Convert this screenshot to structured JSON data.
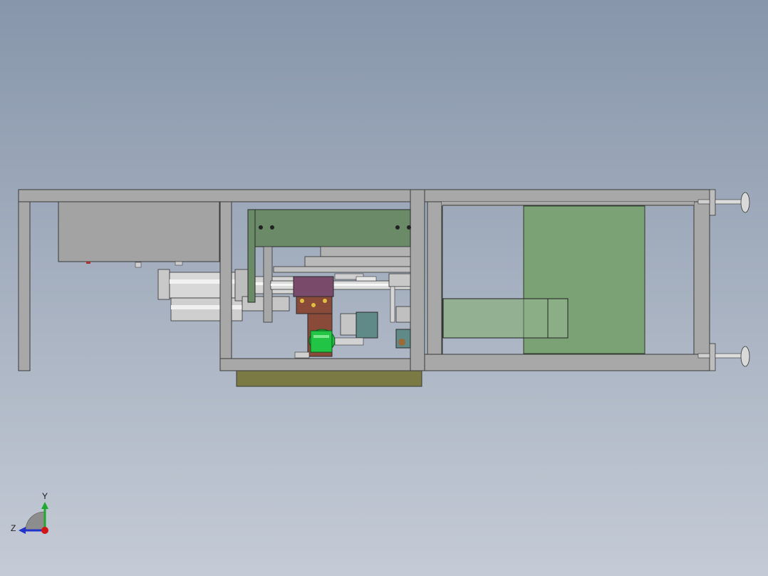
{
  "viewport": {
    "background_top": "#8796ab",
    "background_bottom": "#c4cbd6"
  },
  "model": {
    "frame_color": "#a9a9a9",
    "frame_edge": "#3a3a3a",
    "panel_green": "#7aa274",
    "panel_green_light": "#8fb08a",
    "base_plate": "#7b7a45",
    "bracket_color": "#6b8a68",
    "motor_color": "#7a4a6a",
    "bracket_red": "#8a4a3a",
    "roller_green": "#1fbf3f"
  },
  "triad": {
    "y_label": "Y",
    "z_label": "Z",
    "y_color": "#1faa2f",
    "z_color": "#2233cc",
    "x_color": "#d01515"
  }
}
